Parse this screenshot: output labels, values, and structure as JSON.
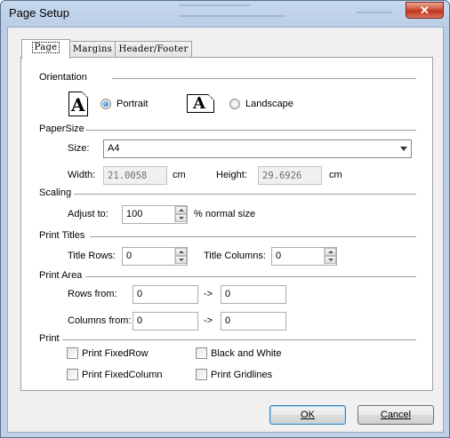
{
  "window": {
    "title": "Page Setup",
    "close_glyph": "✕"
  },
  "tabs": [
    "Page",
    "Margins",
    "Header/Footer"
  ],
  "orientation": {
    "heading": "Orientation",
    "icon_glyph": "A",
    "options": [
      {
        "label": "Portrait",
        "selected": true
      },
      {
        "label": "Landscape",
        "selected": false
      }
    ]
  },
  "paper": {
    "heading": "PaperSize",
    "size_label": "Size:",
    "size_value": "A4",
    "width_label": "Width:",
    "width_value": "21.0058",
    "width_unit": "cm",
    "height_label": "Height:",
    "height_value": "29.6926",
    "height_unit": "cm"
  },
  "scaling": {
    "heading": "Scaling",
    "adjust_label": "Adjust to:",
    "adjust_value": "100",
    "suffix": "% normal size"
  },
  "print_titles": {
    "heading": "Print Titles",
    "rows_label": "Title Rows:",
    "rows_value": "0",
    "cols_label": "Title Columns:",
    "cols_value": "0"
  },
  "print_area": {
    "heading": "Print Area",
    "rows_label": "Rows from:",
    "rows_from": "0",
    "rows_to": "0",
    "cols_label": "Columns from:",
    "cols_from": "0",
    "cols_to": "0",
    "arrow": "->"
  },
  "print": {
    "heading": "Print",
    "options": [
      {
        "label": "Print FixedRow",
        "checked": false
      },
      {
        "label": "Black and White",
        "checked": false
      },
      {
        "label": "Print FixedColumn",
        "checked": false
      },
      {
        "label": "Print Gridlines",
        "checked": false
      }
    ]
  },
  "buttons": {
    "ok": "OK",
    "cancel": "Cancel"
  }
}
